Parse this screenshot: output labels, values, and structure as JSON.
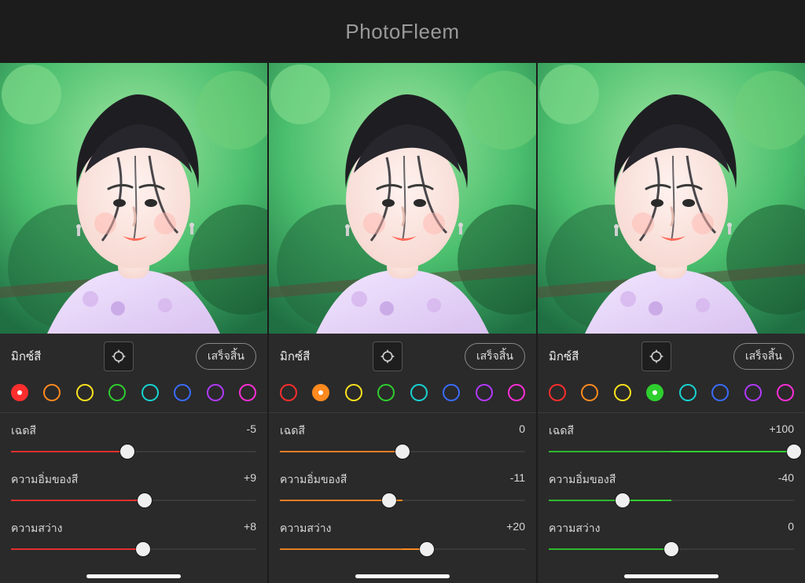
{
  "header": {
    "title": "PhotoFleem"
  },
  "swatch_colors": [
    "#ff2e2e",
    "#ff8a1f",
    "#ffe21f",
    "#2fce2f",
    "#18d3d3",
    "#3a6cff",
    "#b23aff",
    "#ff2fd6"
  ],
  "panels": [
    {
      "mix_label": "มิกซ์สี",
      "done_label": "เสร็จสิ้น",
      "selected_swatch": 0,
      "accent": "#ff2e2e",
      "sliders": [
        {
          "label": "เฉดสี",
          "value": -5
        },
        {
          "label": "ความอิ่มของสี",
          "value": 9
        },
        {
          "label": "ความสว่าง",
          "value": 8
        }
      ]
    },
    {
      "mix_label": "มิกซ์สี",
      "done_label": "เสร็จสิ้น",
      "selected_swatch": 1,
      "accent": "#ff8a1f",
      "sliders": [
        {
          "label": "เฉดสี",
          "value": 0
        },
        {
          "label": "ความอิ่มของสี",
          "value": -11
        },
        {
          "label": "ความสว่าง",
          "value": 20
        }
      ]
    },
    {
      "mix_label": "มิกซ์สี",
      "done_label": "เสร็จสิ้น",
      "selected_swatch": 3,
      "accent": "#2fce2f",
      "sliders": [
        {
          "label": "เฉดสี",
          "value": 100
        },
        {
          "label": "ความอิ่มของสี",
          "value": -40
        },
        {
          "label": "ความสว่าง",
          "value": 0
        }
      ]
    }
  ]
}
